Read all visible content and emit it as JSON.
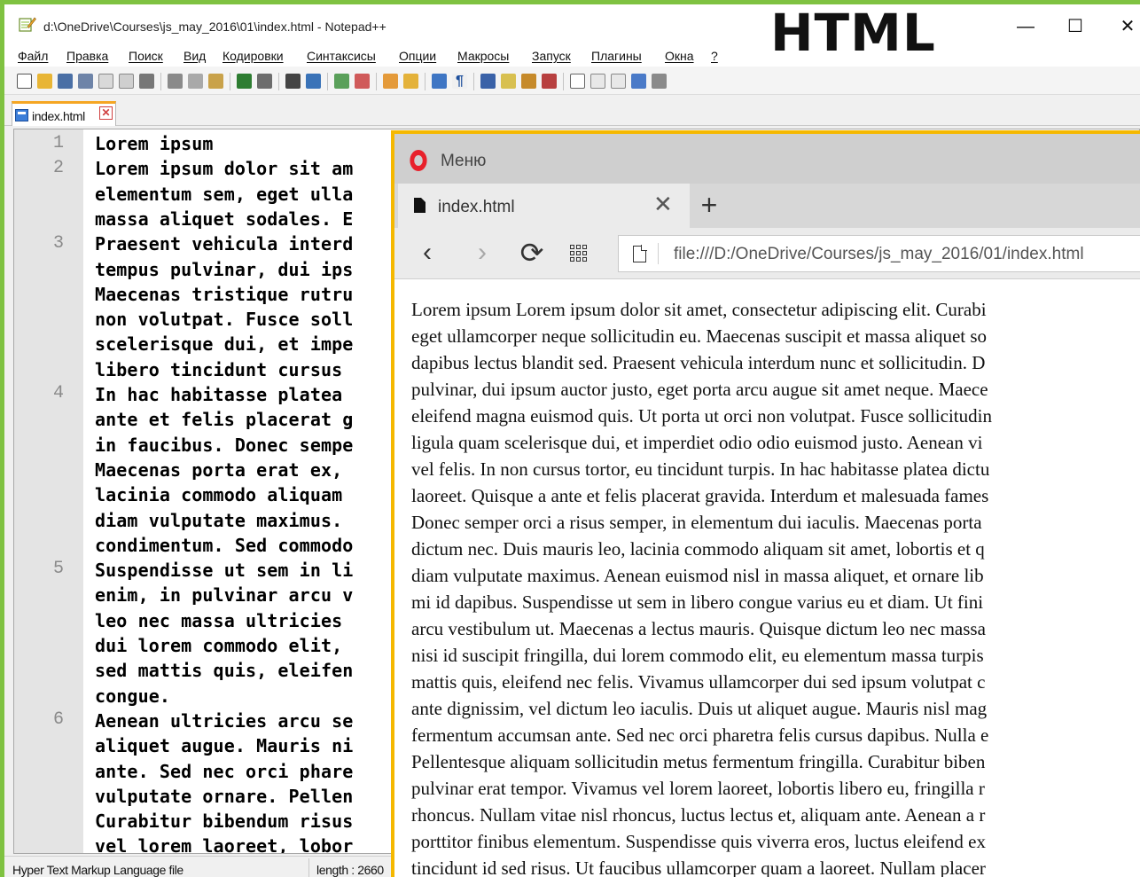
{
  "overlay": {
    "label": "HTML"
  },
  "notepad": {
    "title": "d:\\OneDrive\\Courses\\js_may_2016\\01\\index.html - Notepad++",
    "window_controls": {
      "minimize": "—",
      "maximize": "☐",
      "close": "✕"
    },
    "menu": [
      "Файл",
      "Правка",
      "Поиск",
      "Вид",
      "Кодировки",
      "Синтаксисы",
      "Опции",
      "Макросы",
      "Запуск",
      "Плагины",
      "Окна",
      "?"
    ],
    "tab": {
      "label": "index.html",
      "close": "✕"
    },
    "line_numbers": [
      "1",
      "2",
      "3",
      "4",
      "5",
      "6"
    ],
    "code_lines": [
      "Lorem ipsum",
      "Lorem ipsum dolor sit am",
      "elementum sem, eget ulla",
      "massa aliquet sodales. E",
      "Praesent vehicula interd",
      "tempus pulvinar, dui ips",
      "Maecenas tristique rutru",
      "non volutpat. Fusce soll",
      "scelerisque dui, et impe",
      "libero tincidunt cursus",
      "In hac habitasse platea",
      "ante et felis placerat g",
      "in faucibus. Donec sempe",
      "Maecenas porta erat ex,",
      "lacinia commodo aliquam",
      "diam vulputate maximus.",
      "condimentum. Sed commodo",
      "Suspendisse ut sem in li",
      "enim, in pulvinar arcu v",
      "leo nec massa ultricies",
      "dui lorem commodo elit,",
      "sed mattis quis, eleifen",
      "congue.",
      "Aenean ultricies arcu se",
      "aliquet augue. Mauris ni",
      "ante. Sed nec orci phare",
      "vulputate ornare. Pellen",
      "Curabitur bibendum risus",
      "vel lorem laoreet, lobor"
    ],
    "status": {
      "file_type": "Hyper Text Markup Language file",
      "length": "length : 2660"
    }
  },
  "opera": {
    "menu_label": "Меню",
    "tab": {
      "label": "index.html",
      "close": "✕"
    },
    "new_tab": "+",
    "nav": {
      "back": "‹",
      "forward": "›",
      "reload": "⟳"
    },
    "address": "file:///D:/OneDrive/Courses/js_may_2016/01/index.html",
    "page_lines": [
      "Lorem ipsum Lorem ipsum dolor sit amet, consectetur adipiscing elit. Curabi",
      "eget ullamcorper neque sollicitudin eu. Maecenas suscipit et massa aliquet so",
      "dapibus lectus blandit sed. Praesent vehicula interdum nunc et sollicitudin. D",
      "pulvinar, dui ipsum auctor justo, eget porta arcu augue sit amet neque. Maece",
      "eleifend magna euismod quis. Ut porta ut orci non volutpat. Fusce sollicitudin",
      "ligula quam scelerisque dui, et imperdiet odio odio euismod justo. Aenean vi",
      "vel felis. In non cursus tortor, eu tincidunt turpis. In hac habitasse platea dictu",
      "laoreet. Quisque a ante et felis placerat gravida. Interdum et malesuada fames",
      "Donec semper orci a risus semper, in elementum dui iaculis. Maecenas porta",
      "dictum nec. Duis mauris leo, lacinia commodo aliquam sit amet, lobortis et q",
      "diam vulputate maximus. Aenean euismod nisl in massa aliquet, et ornare lib",
      "mi id dapibus. Suspendisse ut sem in libero congue varius eu et diam. Ut fini",
      "arcu vestibulum ut. Maecenas a lectus mauris. Quisque dictum leo nec massa",
      "nisi id suscipit fringilla, dui lorem commodo elit, eu elementum massa turpis",
      "mattis quis, eleifend nec felis. Vivamus ullamcorper dui sed ipsum volutpat c",
      "ante dignissim, vel dictum leo iaculis. Duis ut aliquet augue. Mauris nisl mag",
      "fermentum accumsan ante. Sed nec orci pharetra felis cursus dapibus. Nulla e",
      "Pellentesque aliquam sollicitudin metus fermentum fringilla. Curabitur biben",
      "pulvinar erat tempor. Vivamus vel lorem laoreet, lobortis libero eu, fringilla r",
      "rhoncus. Nullam vitae nisl rhoncus, luctus lectus et, aliquam ante. Aenean a r",
      "porttitor finibus elementum. Suspendisse quis viverra eros, luctus eleifend ex",
      "tincidunt id sed risus. Ut faucibus ullamcorper quam a laoreet. Nullam placer"
    ]
  }
}
